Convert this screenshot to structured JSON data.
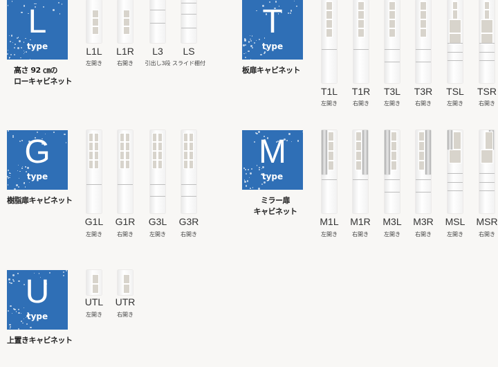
{
  "badge_color": "#2f6fb6",
  "groups": [
    {
      "id": "L",
      "letter": "L",
      "type_label": "type",
      "title": [
        "高さ 92 ㎝の",
        "ローキャビネット"
      ],
      "items": [
        {
          "code": "L1L",
          "sub": "左開き",
          "style": "low-door"
        },
        {
          "code": "L1R",
          "sub": "右開き",
          "style": "low-door"
        },
        {
          "code": "L3",
          "sub": "引出し3段",
          "style": "low-drawer"
        },
        {
          "code": "LS",
          "sub": "スライド棚付",
          "style": "low-slide"
        }
      ]
    },
    {
      "id": "T",
      "letter": "T",
      "type_label": "type",
      "title": [
        "板扉キャビネット"
      ],
      "items": [
        {
          "code": "T1L",
          "sub": "左開き",
          "style": "tall-1"
        },
        {
          "code": "T1R",
          "sub": "右開き",
          "style": "tall-1"
        },
        {
          "code": "T3L",
          "sub": "左開き",
          "style": "tall-3"
        },
        {
          "code": "T3R",
          "sub": "右開き",
          "style": "tall-3"
        },
        {
          "code": "TSL",
          "sub": "左開き",
          "style": "tall-s"
        },
        {
          "code": "TSR",
          "sub": "右開き",
          "style": "tall-s"
        }
      ]
    },
    {
      "id": "G",
      "letter": "G",
      "type_label": "type",
      "title": [
        "樹脂扉キャビネット"
      ],
      "items": [
        {
          "code": "G1L",
          "sub": "左開き",
          "style": "glass-1"
        },
        {
          "code": "G1R",
          "sub": "右開き",
          "style": "glass-1"
        },
        {
          "code": "G3L",
          "sub": "左開き",
          "style": "glass-3"
        },
        {
          "code": "G3R",
          "sub": "右開き",
          "style": "glass-3"
        }
      ]
    },
    {
      "id": "M",
      "letter": "M",
      "type_label": "type",
      "title": [
        "ミラー扉",
        "キャビネット"
      ],
      "items": [
        {
          "code": "M1L",
          "sub": "左開き",
          "style": "mirror-1"
        },
        {
          "code": "M1R",
          "sub": "右開き",
          "style": "mirror-1"
        },
        {
          "code": "M3L",
          "sub": "左開き",
          "style": "mirror-3"
        },
        {
          "code": "M3R",
          "sub": "右開き",
          "style": "mirror-3"
        },
        {
          "code": "MSL",
          "sub": "左開き",
          "style": "mirror-s"
        },
        {
          "code": "MSR",
          "sub": "右開き",
          "style": "mirror-s"
        }
      ]
    },
    {
      "id": "U",
      "letter": "U",
      "type_label": "type",
      "title": [
        "上置きキャビネット"
      ],
      "items": [
        {
          "code": "UTL",
          "sub": "左開き",
          "style": "upper"
        },
        {
          "code": "UTR",
          "sub": "右開き",
          "style": "upper"
        }
      ]
    }
  ]
}
